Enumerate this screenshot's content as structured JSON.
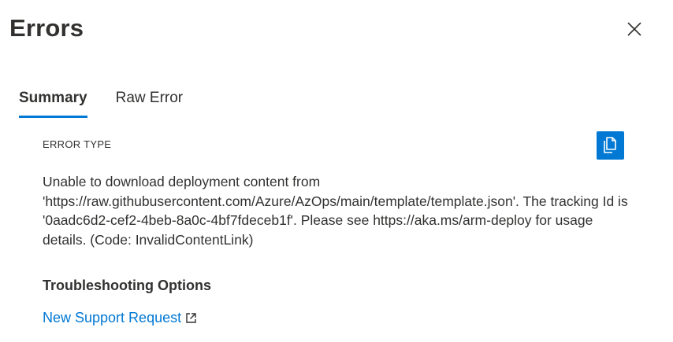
{
  "panel": {
    "title": "Errors",
    "close_icon": "close-icon"
  },
  "tabs": [
    {
      "label": "Summary",
      "active": true
    },
    {
      "label": "Raw Error",
      "active": false
    }
  ],
  "summary": {
    "section_label": "ERROR TYPE",
    "copy_icon": "copy-icon",
    "message": "Unable to download deployment content from 'https://raw.githubusercontent.com/Azure/AzOps/main/template/template.json'. The tracking Id is '0aadc6d2-cef2-4beb-8a0c-4bf7fdeceb1f'. Please see https://aka.ms/arm-deploy for usage details. (Code: InvalidContentLink)"
  },
  "troubleshooting": {
    "heading": "Troubleshooting Options",
    "link_label": "New Support Request",
    "link_icon": "external-link-icon"
  },
  "colors": {
    "accent": "#0078d4",
    "text": "#323130"
  }
}
